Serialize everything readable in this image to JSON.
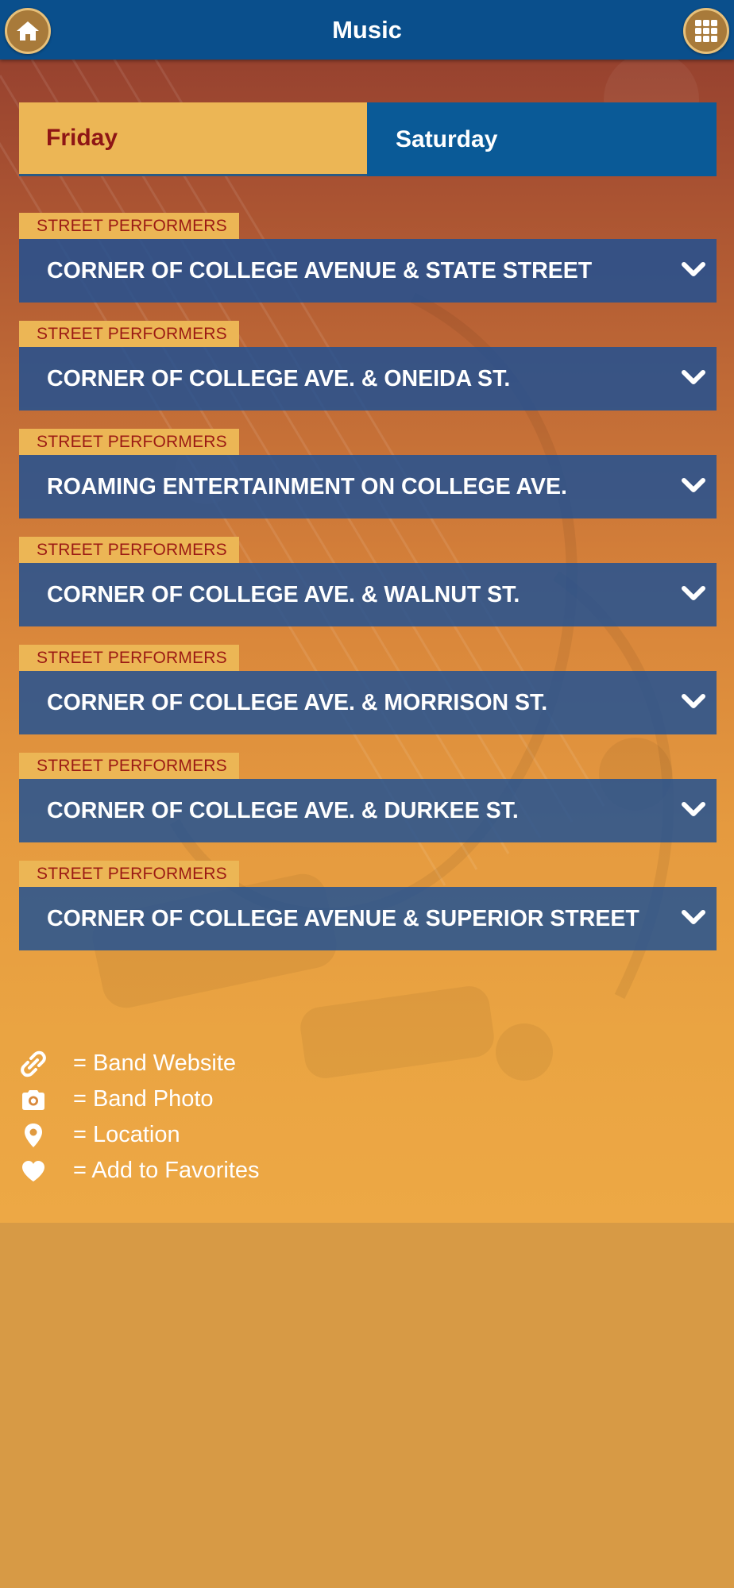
{
  "header": {
    "title": "Music",
    "home_icon": "home-icon",
    "menu_icon": "grid-menu-icon"
  },
  "tabs": [
    {
      "label": "Friday",
      "selected": true
    },
    {
      "label": "Saturday",
      "selected": false
    }
  ],
  "items": [
    {
      "category": "STREET PERFORMERS",
      "title": "CORNER OF COLLEGE AVENUE & STATE STREET"
    },
    {
      "category": "STREET PERFORMERS",
      "title": "CORNER OF COLLEGE AVE. & ONEIDA ST."
    },
    {
      "category": "STREET PERFORMERS",
      "title": "ROAMING ENTERTAINMENT ON COLLEGE AVE."
    },
    {
      "category": "STREET PERFORMERS",
      "title": "CORNER OF COLLEGE AVE. & WALNUT ST."
    },
    {
      "category": "STREET PERFORMERS",
      "title": "CORNER OF COLLEGE AVE. & MORRISON ST."
    },
    {
      "category": "STREET PERFORMERS",
      "title": "CORNER OF COLLEGE AVE. & DURKEE ST."
    },
    {
      "category": "STREET PERFORMERS",
      "title": "CORNER OF COLLEGE AVENUE & SUPERIOR STREET"
    }
  ],
  "legend": [
    {
      "icon": "link-icon",
      "text": "= Band Website"
    },
    {
      "icon": "camera-icon",
      "text": "= Band Photo"
    },
    {
      "icon": "map-pin-icon",
      "text": "= Location"
    },
    {
      "icon": "heart-icon",
      "text": "= Add to Favorites"
    }
  ],
  "colors": {
    "header": "#0a4f8c",
    "tab_selected": "#ecb655",
    "tab_unselected": "#0a5a97",
    "selected_text": "#8e1515",
    "category_label": "#ecb655",
    "item_bar": "#1b4f96",
    "page_bottom": "#d79a45"
  }
}
